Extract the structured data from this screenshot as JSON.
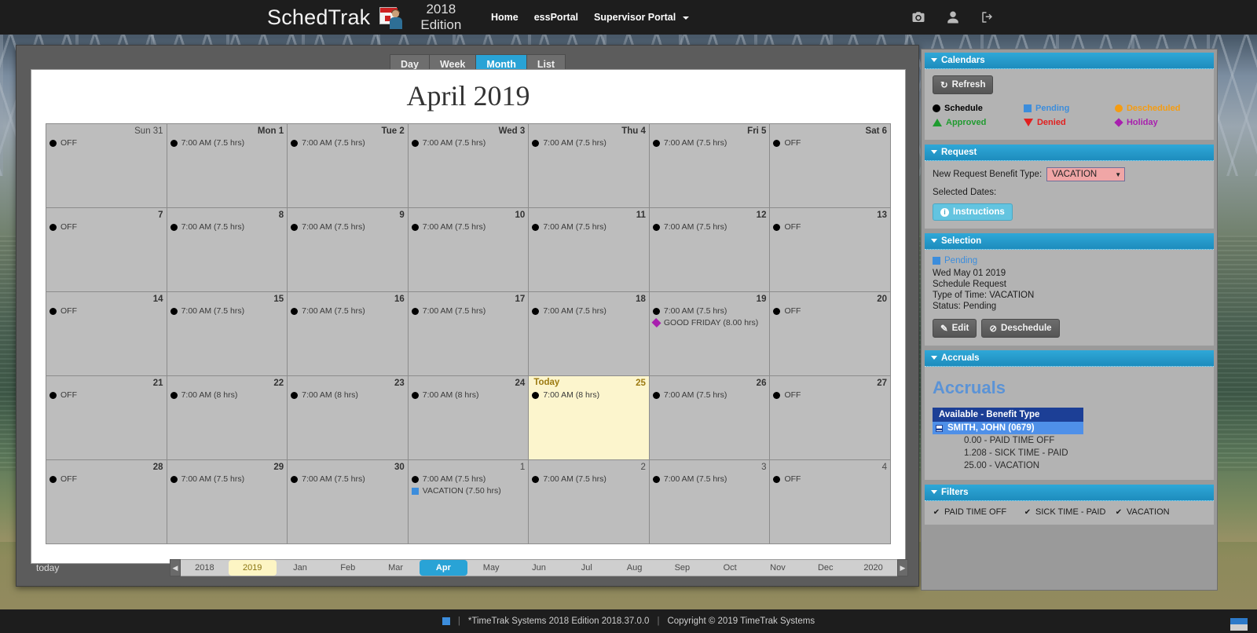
{
  "topnav": {
    "brand": "SchedTrak",
    "logo_icon": "calendar-person-icon",
    "edition_line1": "2018",
    "edition_line2": "Edition",
    "links": [
      {
        "label": "Home",
        "icon": "",
        "has_caret": false
      },
      {
        "label": "essPortal",
        "icon": "",
        "has_caret": false
      },
      {
        "label": "Supervisor Portal",
        "icon": "chevron-down-icon",
        "has_caret": true
      }
    ],
    "icons": [
      {
        "name": "camera-icon"
      },
      {
        "name": "user-icon"
      },
      {
        "name": "sign-out-icon"
      }
    ]
  },
  "calendar": {
    "view_tabs": [
      {
        "label": "Day",
        "active": false
      },
      {
        "label": "Week",
        "active": false
      },
      {
        "label": "Month",
        "active": true
      },
      {
        "label": "List",
        "active": false
      }
    ],
    "title": "April 2019",
    "today_label": "Today",
    "today_button": "today",
    "weeks": [
      [
        {
          "num": "Sun 31",
          "other": true,
          "events": [
            {
              "marker": "circle",
              "color": "#000000",
              "text": "OFF"
            }
          ]
        },
        {
          "num": "Mon 1",
          "other": false,
          "events": [
            {
              "marker": "circle",
              "color": "#000000",
              "text": "7:00 AM (7.5 hrs)"
            }
          ]
        },
        {
          "num": "Tue 2",
          "other": false,
          "events": [
            {
              "marker": "circle",
              "color": "#000000",
              "text": "7:00 AM (7.5 hrs)"
            }
          ]
        },
        {
          "num": "Wed 3",
          "other": false,
          "events": [
            {
              "marker": "circle",
              "color": "#000000",
              "text": "7:00 AM (7.5 hrs)"
            }
          ]
        },
        {
          "num": "Thu 4",
          "other": false,
          "events": [
            {
              "marker": "circle",
              "color": "#000000",
              "text": "7:00 AM (7.5 hrs)"
            }
          ]
        },
        {
          "num": "Fri 5",
          "other": false,
          "events": [
            {
              "marker": "circle",
              "color": "#000000",
              "text": "7:00 AM (7.5 hrs)"
            }
          ]
        },
        {
          "num": "Sat 6",
          "other": false,
          "events": [
            {
              "marker": "circle",
              "color": "#000000",
              "text": "OFF"
            }
          ]
        }
      ],
      [
        {
          "num": "7",
          "other": false,
          "events": [
            {
              "marker": "circle",
              "color": "#000000",
              "text": "OFF"
            }
          ]
        },
        {
          "num": "8",
          "other": false,
          "events": [
            {
              "marker": "circle",
              "color": "#000000",
              "text": "7:00 AM (7.5 hrs)"
            }
          ]
        },
        {
          "num": "9",
          "other": false,
          "events": [
            {
              "marker": "circle",
              "color": "#000000",
              "text": "7:00 AM (7.5 hrs)"
            }
          ]
        },
        {
          "num": "10",
          "other": false,
          "events": [
            {
              "marker": "circle",
              "color": "#000000",
              "text": "7:00 AM (7.5 hrs)"
            }
          ]
        },
        {
          "num": "11",
          "other": false,
          "events": [
            {
              "marker": "circle",
              "color": "#000000",
              "text": "7:00 AM (7.5 hrs)"
            }
          ]
        },
        {
          "num": "12",
          "other": false,
          "events": [
            {
              "marker": "circle",
              "color": "#000000",
              "text": "7:00 AM (7.5 hrs)"
            }
          ]
        },
        {
          "num": "13",
          "other": false,
          "events": [
            {
              "marker": "circle",
              "color": "#000000",
              "text": "OFF"
            }
          ]
        }
      ],
      [
        {
          "num": "14",
          "other": false,
          "events": [
            {
              "marker": "circle",
              "color": "#000000",
              "text": "OFF"
            }
          ]
        },
        {
          "num": "15",
          "other": false,
          "events": [
            {
              "marker": "circle",
              "color": "#000000",
              "text": "7:00 AM (7.5 hrs)"
            }
          ]
        },
        {
          "num": "16",
          "other": false,
          "events": [
            {
              "marker": "circle",
              "color": "#000000",
              "text": "7:00 AM (7.5 hrs)"
            }
          ]
        },
        {
          "num": "17",
          "other": false,
          "events": [
            {
              "marker": "circle",
              "color": "#000000",
              "text": "7:00 AM (7.5 hrs)"
            }
          ]
        },
        {
          "num": "18",
          "other": false,
          "events": [
            {
              "marker": "circle",
              "color": "#000000",
              "text": "7:00 AM (7.5 hrs)"
            }
          ]
        },
        {
          "num": "19",
          "other": false,
          "events": [
            {
              "marker": "circle",
              "color": "#000000",
              "text": "7:00 AM (7.5 hrs)"
            },
            {
              "marker": "diamond",
              "color": "#a81fae",
              "text": "GOOD FRIDAY (8.00 hrs)"
            }
          ]
        },
        {
          "num": "20",
          "other": false,
          "events": [
            {
              "marker": "circle",
              "color": "#000000",
              "text": "OFF"
            }
          ]
        }
      ],
      [
        {
          "num": "21",
          "other": false,
          "events": [
            {
              "marker": "circle",
              "color": "#000000",
              "text": "OFF"
            }
          ]
        },
        {
          "num": "22",
          "other": false,
          "events": [
            {
              "marker": "circle",
              "color": "#000000",
              "text": "7:00 AM (8 hrs)"
            }
          ]
        },
        {
          "num": "23",
          "other": false,
          "events": [
            {
              "marker": "circle",
              "color": "#000000",
              "text": "7:00 AM (8 hrs)"
            }
          ]
        },
        {
          "num": "24",
          "other": false,
          "events": [
            {
              "marker": "circle",
              "color": "#000000",
              "text": "7:00 AM (8 hrs)"
            }
          ]
        },
        {
          "num": "25",
          "other": false,
          "today": true,
          "events": [
            {
              "marker": "circle",
              "color": "#000000",
              "text": "7:00 AM (8 hrs)"
            }
          ]
        },
        {
          "num": "26",
          "other": false,
          "events": [
            {
              "marker": "circle",
              "color": "#000000",
              "text": "7:00 AM (7.5 hrs)"
            }
          ]
        },
        {
          "num": "27",
          "other": false,
          "events": [
            {
              "marker": "circle",
              "color": "#000000",
              "text": "OFF"
            }
          ]
        }
      ],
      [
        {
          "num": "28",
          "other": false,
          "events": [
            {
              "marker": "circle",
              "color": "#000000",
              "text": "OFF"
            }
          ]
        },
        {
          "num": "29",
          "other": false,
          "events": [
            {
              "marker": "circle",
              "color": "#000000",
              "text": "7:00 AM (7.5 hrs)"
            }
          ]
        },
        {
          "num": "30",
          "other": false,
          "events": [
            {
              "marker": "circle",
              "color": "#000000",
              "text": "7:00 AM (7.5 hrs)"
            }
          ]
        },
        {
          "num": "1",
          "other": true,
          "events": [
            {
              "marker": "circle",
              "color": "#000000",
              "text": "7:00 AM (7.5 hrs)"
            },
            {
              "marker": "square",
              "color": "#3c8ddc",
              "text": "VACATION (7.50 hrs)"
            }
          ]
        },
        {
          "num": "2",
          "other": true,
          "events": [
            {
              "marker": "circle",
              "color": "#000000",
              "text": "7:00 AM (7.5 hrs)"
            }
          ]
        },
        {
          "num": "3",
          "other": true,
          "events": [
            {
              "marker": "circle",
              "color": "#000000",
              "text": "7:00 AM (7.5 hrs)"
            }
          ]
        },
        {
          "num": "4",
          "other": true,
          "events": [
            {
              "marker": "circle",
              "color": "#000000",
              "text": "OFF"
            }
          ]
        }
      ]
    ],
    "scroller": {
      "prev_icon": "chevron-left-icon",
      "next_icon": "chevron-right-icon",
      "ticks": [
        {
          "label": "2018",
          "kind": "year",
          "selected": false
        },
        {
          "label": "2019",
          "kind": "year",
          "selected": true
        },
        {
          "label": "Jan",
          "kind": "month",
          "selected": false
        },
        {
          "label": "Feb",
          "kind": "month",
          "selected": false
        },
        {
          "label": "Mar",
          "kind": "month",
          "selected": false
        },
        {
          "label": "Apr",
          "kind": "month",
          "selected": true
        },
        {
          "label": "May",
          "kind": "month",
          "selected": false
        },
        {
          "label": "Jun",
          "kind": "month",
          "selected": false
        },
        {
          "label": "Jul",
          "kind": "month",
          "selected": false
        },
        {
          "label": "Aug",
          "kind": "month",
          "selected": false
        },
        {
          "label": "Sep",
          "kind": "month",
          "selected": false
        },
        {
          "label": "Oct",
          "kind": "month",
          "selected": false
        },
        {
          "label": "Nov",
          "kind": "month",
          "selected": false
        },
        {
          "label": "Dec",
          "kind": "month",
          "selected": false
        },
        {
          "label": "2020",
          "kind": "year",
          "selected": false
        }
      ]
    }
  },
  "sidebar": {
    "calendars": {
      "header": "Calendars",
      "refresh_label": "Refresh",
      "refresh_icon": "refresh-icon",
      "legend": [
        {
          "label": "Schedule",
          "shape": "circle",
          "color": "#000000"
        },
        {
          "label": "Pending",
          "shape": "square",
          "color": "#3c8ddc"
        },
        {
          "label": "Descheduled",
          "shape": "circle",
          "color": "#f59c11"
        },
        {
          "label": "Approved",
          "shape": "triangle-up",
          "color": "#1f9b2f"
        },
        {
          "label": "Denied",
          "shape": "triangle-down",
          "color": "#e21f1f"
        },
        {
          "label": "Holiday",
          "shape": "diamond",
          "color": "#a81fae"
        }
      ]
    },
    "request": {
      "header": "Request",
      "benefit_type_label": "New Request Benefit Type:",
      "benefit_type_value": "VACATION",
      "benefit_type_options": [
        "VACATION",
        "PAID TIME OFF",
        "SICK TIME - PAID"
      ],
      "selected_dates_label": "Selected Dates:",
      "selected_dates_value": "",
      "instructions_label": "Instructions",
      "instructions_icon": "info-icon"
    },
    "selection": {
      "header": "Selection",
      "status_badge": "Pending",
      "status_color": "#3c8ddc",
      "date": "Wed May 01 2019",
      "kind": "Schedule Request",
      "type_of_time": "Type of Time: VACATION",
      "status": "Status: Pending",
      "edit_label": "Edit",
      "edit_icon": "pencil-icon",
      "deschedule_label": "Deschedule",
      "deschedule_icon": "no-entry-icon"
    },
    "accruals": {
      "header": "Accruals",
      "title": "Accruals",
      "column_header": "Available   -   Benefit Type",
      "employee": "SMITH, JOHN (0679)",
      "rows": [
        {
          "available": "0.00",
          "sep": "-",
          "benefit": "PAID TIME OFF"
        },
        {
          "available": "1.208",
          "sep": "-",
          "benefit": "SICK TIME - PAID"
        },
        {
          "available": "25.00",
          "sep": "-",
          "benefit": "VACATION"
        }
      ]
    },
    "filters": {
      "header": "Filters",
      "items": [
        {
          "label": "PAID TIME OFF",
          "checked": true
        },
        {
          "label": "SICK TIME - PAID",
          "checked": true
        },
        {
          "label": "VACATION",
          "checked": true
        }
      ]
    }
  },
  "footer": {
    "product": "*TimeTrak Systems 2018 Edition 2018.37.0.0",
    "sep1": "|",
    "sep2": "|",
    "copyright": "Copyright © 2019 TimeTrak Systems"
  }
}
